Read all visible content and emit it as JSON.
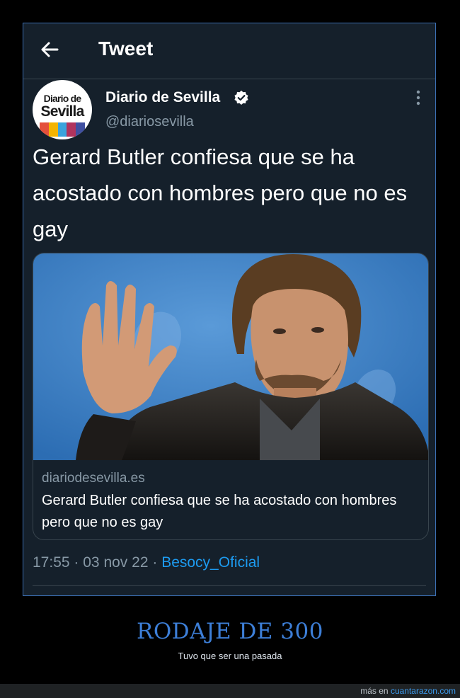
{
  "header": {
    "title": "Tweet",
    "back_icon": "arrow-left-icon"
  },
  "tweet": {
    "author": {
      "name": "Diario de Sevilla",
      "handle": "@diariosevilla",
      "verified": true,
      "avatar_logo_top": "Diario de",
      "avatar_logo_bottom": "Sevilla"
    },
    "text": "Gerard Butler confiesa que se ha acostado con hombres pero que no es gay",
    "card": {
      "domain": "diariodesevilla.es",
      "title": "Gerard Butler confiesa que se ha acostado con hombres pero que no es gay",
      "image_alt": "photo of a bearded man in a leather jacket waving in front of a blue backdrop"
    },
    "time": "17:55",
    "date": "03 nov 22",
    "separator": "·",
    "source": "Besocy_Oficial"
  },
  "caption": {
    "title": "RODAJE DE 300",
    "subtitle": "Tuvo que ser una pasada"
  },
  "footer": {
    "prefix": "más en",
    "link": "cuantarazon.com"
  },
  "colors": {
    "background": "#15202b",
    "text": "#ffffff",
    "secondary": "#8899a6",
    "link": "#1d9bf0",
    "caption": "#3d7fd8"
  }
}
